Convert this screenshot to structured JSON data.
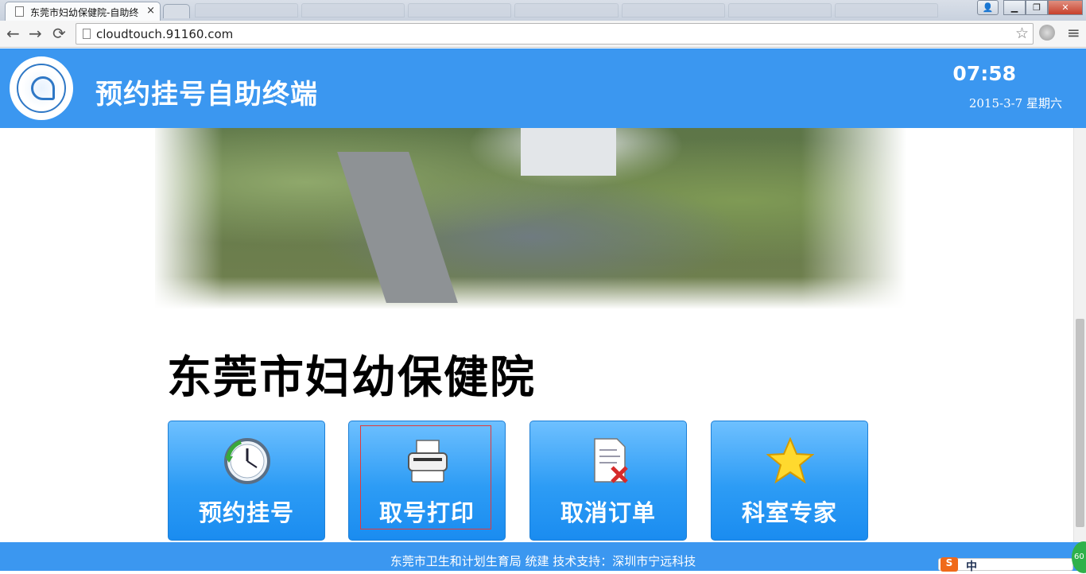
{
  "browser": {
    "tab_title": "东莞市妇幼保健院-自助终",
    "tab_close": "×",
    "url": "cloudtouch.91160.com",
    "win_minimize": "▁",
    "win_maximize": "❐",
    "win_close": "✕",
    "user": "👤"
  },
  "header": {
    "title": "预约挂号自助终端",
    "time": "07:58",
    "date": "2015-3-7 星期六"
  },
  "main": {
    "hospital_name": "东莞市妇幼保健院",
    "tiles": [
      {
        "label": "预约挂号",
        "icon": "clock-icon"
      },
      {
        "label": "取号打印",
        "icon": "printer-icon"
      },
      {
        "label": "取消订单",
        "icon": "cancel-document-icon"
      },
      {
        "label": "科室专家",
        "icon": "star-icon"
      }
    ]
  },
  "footer": {
    "text": "东莞市卫生和计划生育局 统建 技术支持：深圳市宁远科技"
  },
  "taskbar": {
    "ime_logo": "S",
    "ime_mode": "中",
    "badge": "60"
  },
  "colors": {
    "header_blue": "#3b97f0",
    "tile_blue": "#2d9cf5",
    "selection_red": "#e23a3a"
  }
}
